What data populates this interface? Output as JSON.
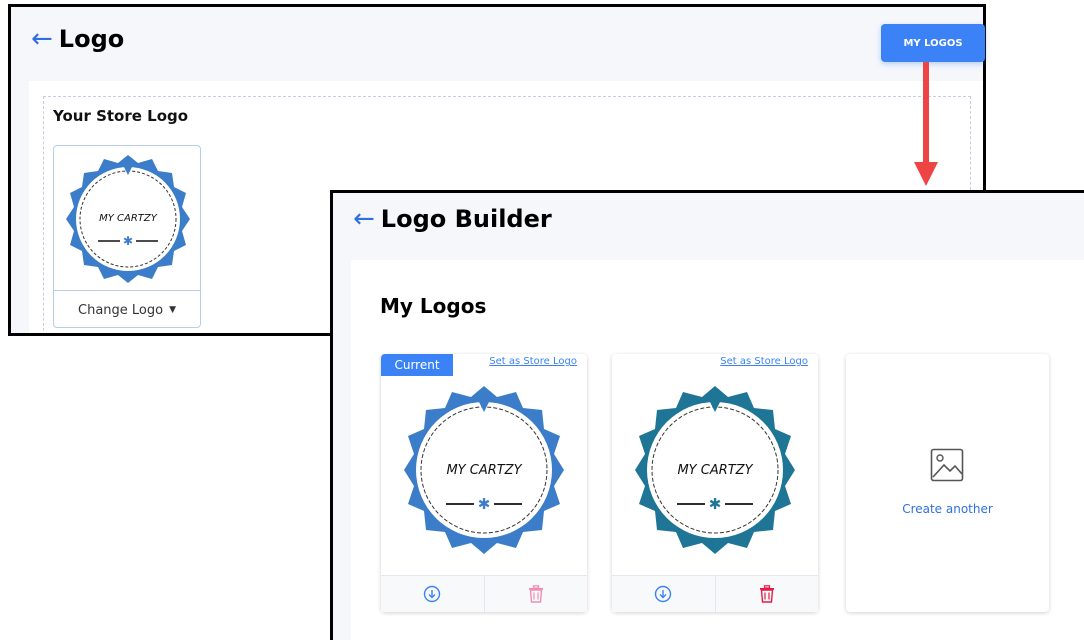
{
  "back_page": {
    "title": "Logo",
    "my_logos_button": "MY LOGOS",
    "store_logo_title": "Your Store Logo",
    "logo_text": "MY CARTZY",
    "change_logo_label": "Change Logo"
  },
  "front_page": {
    "title": "Logo Builder",
    "section_title": "My Logos",
    "cards": [
      {
        "badge": "Current",
        "set_link": "Set as Store Logo",
        "logo_text": "MY CARTZY",
        "color": "#3b7dc9"
      },
      {
        "set_link": "Set as Store Logo",
        "logo_text": "MY CARTZY",
        "color": "#1e7596"
      }
    ],
    "create_label": "Create another"
  },
  "colors": {
    "accent": "#3b82f6",
    "arrow_red": "#ef4444",
    "delete_light": "#f08fb0",
    "delete_red": "#e11d48"
  }
}
